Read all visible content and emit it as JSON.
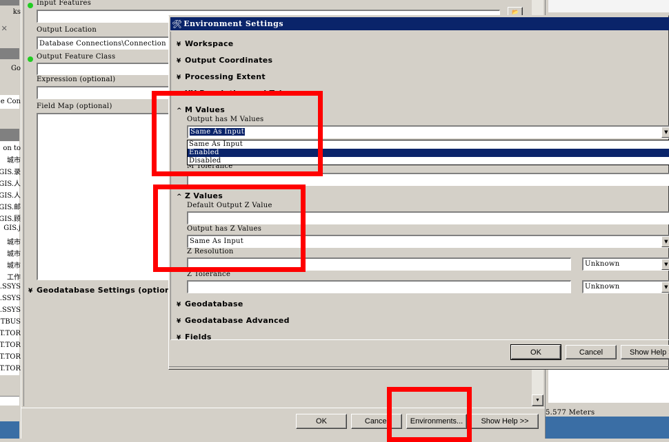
{
  "background": {
    "left_texts": [
      "ks",
      "Go",
      "e Con",
      "on to"
    ],
    "left_list": [
      "城市",
      "GIS.录",
      "GIS.人",
      "GIS.人",
      "GIS.邮",
      "GIS.顾",
      "GIS.j",
      "城市",
      "城市",
      "城市",
      "工作",
      "SSYS.",
      "SSYS.",
      "SSYS.",
      "TBUS",
      "T.TOR",
      "T.TOR",
      "T.TOR",
      "T.TOR"
    ],
    "status_text": "5.577 Meters"
  },
  "tool_dialog": {
    "params": [
      {
        "label": "Input Features",
        "value": "",
        "required": true
      },
      {
        "label": "Output Location",
        "value": "Database Connections\\Connection",
        "required": false
      },
      {
        "label": "Output Feature Class",
        "value": "",
        "required": true
      },
      {
        "label": "Expression (optional)",
        "value": "",
        "required": false
      },
      {
        "label": "Field Map (optional)",
        "value": "",
        "required": false
      }
    ],
    "geodatabase_settings": "Geodatabase Settings (optional)",
    "buttons": {
      "ok": "OK",
      "cancel": "Cancel",
      "environments": "Environments...",
      "show_help": "Show Help >>"
    }
  },
  "env_dialog": {
    "title": "Environment Settings",
    "sections": {
      "workspace": "Workspace",
      "output_coordinates": "Output Coordinates",
      "processing_extent": "Processing Extent",
      "xy_resolution": "XY Resolution and Tolerance",
      "m_values": "M Values",
      "z_values": "Z Values",
      "geodatabase": "Geodatabase",
      "geodatabase_advanced": "Geodatabase Advanced",
      "fields": "Fields"
    },
    "m": {
      "output_has_m_label": "Output has M Values",
      "output_has_m_value": "Same As Input",
      "options": [
        "Same As Input",
        "Enabled",
        "Disabled"
      ],
      "highlighted_option": "Enabled",
      "m_tolerance_label": "M Tolerance"
    },
    "z": {
      "default_z_label": "Default Output Z Value",
      "default_z_value": "",
      "output_has_z_label": "Output has Z Values",
      "output_has_z_value": "Same As Input",
      "z_resolution_label": "Z Resolution",
      "z_resolution_unit": "Unknown",
      "z_tolerance_label": "Z Tolerance",
      "z_tolerance_unit": "Unknown"
    },
    "buttons": {
      "ok": "OK",
      "cancel": "Cancel",
      "show_help": "Show Help >>"
    }
  },
  "colors": {
    "title_bar": "#0a246a",
    "highlight": "#0a246a",
    "annotation": "#ff0000",
    "required_dot": "#22cc22"
  }
}
